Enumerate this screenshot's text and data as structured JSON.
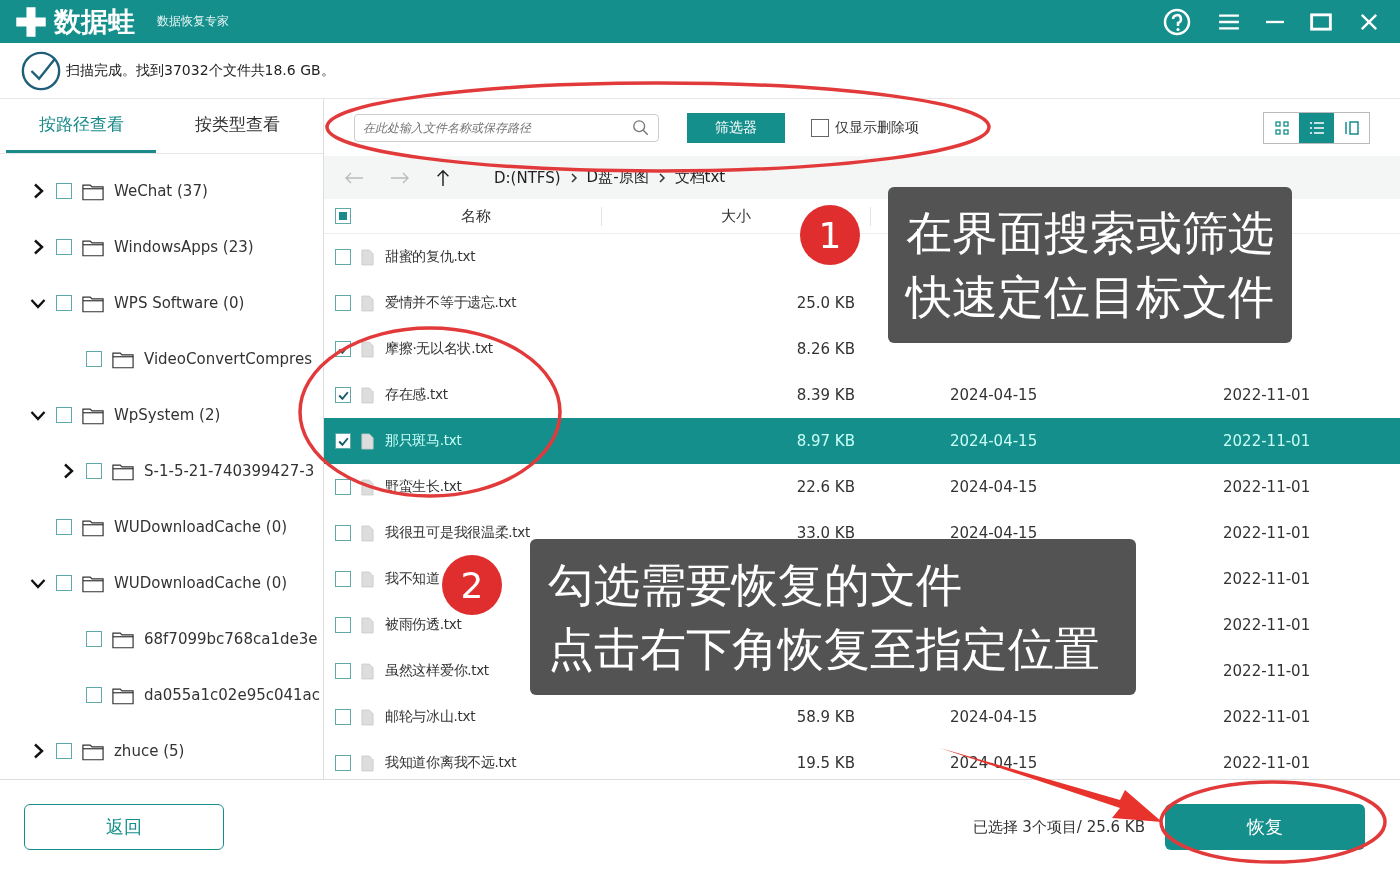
{
  "title_bar": {
    "logo_text": "数据蛙",
    "subtitle": "数据恢复专家"
  },
  "scan_status": "扫描完成。找到37032个文件共18.6 GB。",
  "view_tabs": [
    {
      "label": "按路径查看",
      "selected": true
    },
    {
      "label": "按类型查看",
      "selected": false
    }
  ],
  "search": {
    "placeholder": "在此处输入文件名称或保存路径"
  },
  "filter_button": "筛选器",
  "deleted_only": {
    "label": "仅显示删除项",
    "checked": false
  },
  "view_modes": [
    {
      "kind": "grid",
      "selected": false
    },
    {
      "kind": "list",
      "selected": true
    },
    {
      "kind": "detail",
      "selected": false
    }
  ],
  "breadcrumb": [
    "D:(NTFS)",
    "D盘-原图",
    "文档txt"
  ],
  "folder_tree": [
    {
      "name": "WeChat (37)",
      "expandable": true,
      "expanded": false,
      "checked": false
    },
    {
      "name": "WindowsApps (23)",
      "expandable": true,
      "expanded": false,
      "checked": false
    },
    {
      "name": "WPS Software (0)",
      "expandable": true,
      "expanded": true,
      "checked": false,
      "children": [
        {
          "name": "VideoConvertCompres",
          "expandable": false,
          "expanded": false,
          "checked": false
        }
      ]
    },
    {
      "name": "WpSystem (2)",
      "expandable": true,
      "expanded": true,
      "checked": false,
      "children": [
        {
          "name": "S-1-5-21-740399427-3",
          "expandable": true,
          "expanded": false,
          "checked": false
        }
      ]
    },
    {
      "name": "WUDownloadCache (0)",
      "expandable": false,
      "expanded": false,
      "checked": false
    },
    {
      "name": "WUDownloadCache (0)",
      "expandable": true,
      "expanded": true,
      "checked": false,
      "children": [
        {
          "name": "68f7099bc768ca1de3e",
          "expandable": false,
          "expanded": false,
          "checked": false
        },
        {
          "name": "da055a1c02e95c041ac",
          "expandable": false,
          "expanded": false,
          "checked": false
        }
      ]
    },
    {
      "name": "zhuce (5)",
      "expandable": true,
      "expanded": false,
      "checked": false
    }
  ],
  "table": {
    "select_all_partial": true,
    "columns": [
      "名称",
      "大小"
    ],
    "rows": [
      {
        "name": "甜蜜的复仇.txt",
        "checked": false,
        "selected": false
      },
      {
        "name": "爱情并不等于遗忘.txt",
        "size": "25.0 KB",
        "checked": false,
        "selected": false
      },
      {
        "name": "摩擦·无以名状.txt",
        "size": "8.26 KB",
        "checked": true,
        "selected": false
      },
      {
        "name": "存在感.txt",
        "size": "8.39 KB",
        "modified": "2024-04-15",
        "created": "2022-11-01",
        "checked": true,
        "selected": false
      },
      {
        "name": "那只斑马.txt",
        "size": "8.97 KB",
        "modified": "2024-04-15",
        "created": "2022-11-01",
        "checked": true,
        "selected": true
      },
      {
        "name": "野蛮生长.txt",
        "size": "22.6 KB",
        "modified": "2024-04-15",
        "created": "2022-11-01",
        "checked": false,
        "selected": false
      },
      {
        "name": "我很丑可是我很温柔.txt",
        "size": "33.0 KB",
        "modified": "2024-04-15",
        "created": "2022-11-01",
        "checked": false,
        "selected": false
      },
      {
        "name": "我不知道",
        "created": "2022-11-01",
        "checked": false,
        "selected": false
      },
      {
        "name": "被雨伤透.txt",
        "created": "2022-11-01",
        "checked": false,
        "selected": false
      },
      {
        "name": "虽然这样爱你.txt",
        "created": "2022-11-01",
        "checked": false,
        "selected": false
      },
      {
        "name": "邮轮与冰山.txt",
        "size": "58.9 KB",
        "modified": "2024-04-15",
        "created": "2022-11-01",
        "checked": false,
        "selected": false
      },
      {
        "name": "我知道你离我不远.txt",
        "size": "19.5 KB",
        "modified": "2024-04-15",
        "created": "2022-11-01",
        "checked": false,
        "selected": false
      }
    ]
  },
  "back_button": "返回",
  "selection_summary": "已选择 3个项目/ 25.6 KB",
  "recover_button": "恢复",
  "callouts": [
    {
      "number": "1",
      "lines": [
        "在界面搜索或筛选",
        "快速定位目标文件"
      ]
    },
    {
      "number": "2",
      "lines": [
        "勾选需要恢复的文件",
        "点击右下角恢复至指定位置"
      ]
    }
  ]
}
